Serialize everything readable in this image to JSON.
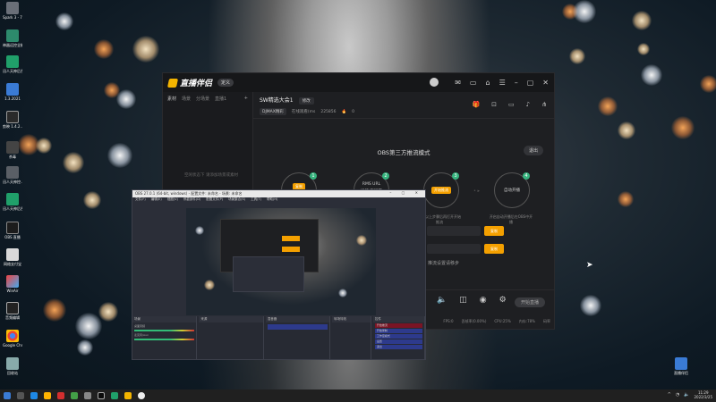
{
  "desktop": {
    "icons": [
      {
        "label": "Spark 3 - 7.3.0 (U...",
        "icon": "app-icon"
      },
      {
        "label": "神器远控全能机",
        "icon": "app-icon"
      },
      {
        "label": "迅人天神后台方式 - 直播...",
        "icon": "app-icon"
      },
      {
        "label": "1.3.2021",
        "icon": "app-icon"
      },
      {
        "label": "剪映 1.4.2...",
        "icon": "app-icon"
      },
      {
        "label": "杀毒",
        "icon": "app-icon"
      },
      {
        "label": "迅人天神控...",
        "icon": "app-icon"
      },
      {
        "label": "迅人天神后台方式 - 视频...",
        "icon": "app-icon"
      },
      {
        "label": "OBS 直播",
        "icon": "app-icon"
      },
      {
        "label": "网络支付宝",
        "icon": "app-icon"
      },
      {
        "label": "WinAir",
        "icon": "app-icon"
      },
      {
        "label": "音频编辑",
        "icon": "app-icon"
      },
      {
        "label": "Google Chrome",
        "icon": "app-icon"
      },
      {
        "label": "回收站",
        "icon": "app-icon"
      }
    ],
    "right_icon": {
      "label": "直播伴侣",
      "icon": "app-icon"
    }
  },
  "app": {
    "title": "直播伴侣",
    "version_badge": "定义",
    "left_tabs": [
      "素材",
      "场景",
      "分场景",
      "直播1"
    ],
    "left_add": "+",
    "left_empty_text": "空闲状态下 请添加场景或素材",
    "scene": {
      "title": "SW精选大会1",
      "edit_chip": "修改",
      "tag": "DJMAX精彩",
      "viewers_label": "在线观看(ms",
      "viewers_value": "225856",
      "likes": "0"
    },
    "obs_mode_title": "OBS第三方推流模式",
    "exit_button": "退出",
    "steps": [
      {
        "num": "1",
        "label": "",
        "btn1": "复制",
        "btn2": "复制"
      },
      {
        "num": "2",
        "label": "RMS URL",
        "sub": "推流/串码等"
      },
      {
        "num": "3",
        "btn": "开始推流"
      },
      {
        "num": "4",
        "label": "自动开播",
        "note": "开启自动开播后在OBS中开播"
      }
    ],
    "step3_note": "完成以上步骤后再打开开始推流",
    "copy_button": "复制",
    "bottom_hint": "推流设置请移步",
    "live_button": "开始直播",
    "status": [
      "FPS:0",
      "丢帧率(0.00%)",
      "CPU:25%",
      "内存:78%",
      "码率"
    ]
  },
  "obs": {
    "title": "OBS 27.0.1 (64-bit, windows) - 配置文件: 未命名 - 场景: 未命名",
    "menu": [
      "文件(F)",
      "编辑(E)",
      "视图(V)",
      "停靠部件(D)",
      "配置文件(P)",
      "场景集合(S)",
      "工具(T)",
      "帮助(H)"
    ],
    "docks": [
      "场景",
      "来源",
      "混音器",
      "转场特效",
      "控件"
    ],
    "controls": [
      "开始推流",
      "开始录制",
      "工作室模式",
      "设置",
      "退出"
    ],
    "audio": [
      "桌面音频",
      "麦克风/Aux"
    ]
  },
  "taskbar": {
    "time": "11:29",
    "date": "2022/3/25"
  },
  "colors": {
    "accent": "#f4a000",
    "step_badge": "#36b37e",
    "app_bg": "#1e1f22"
  }
}
